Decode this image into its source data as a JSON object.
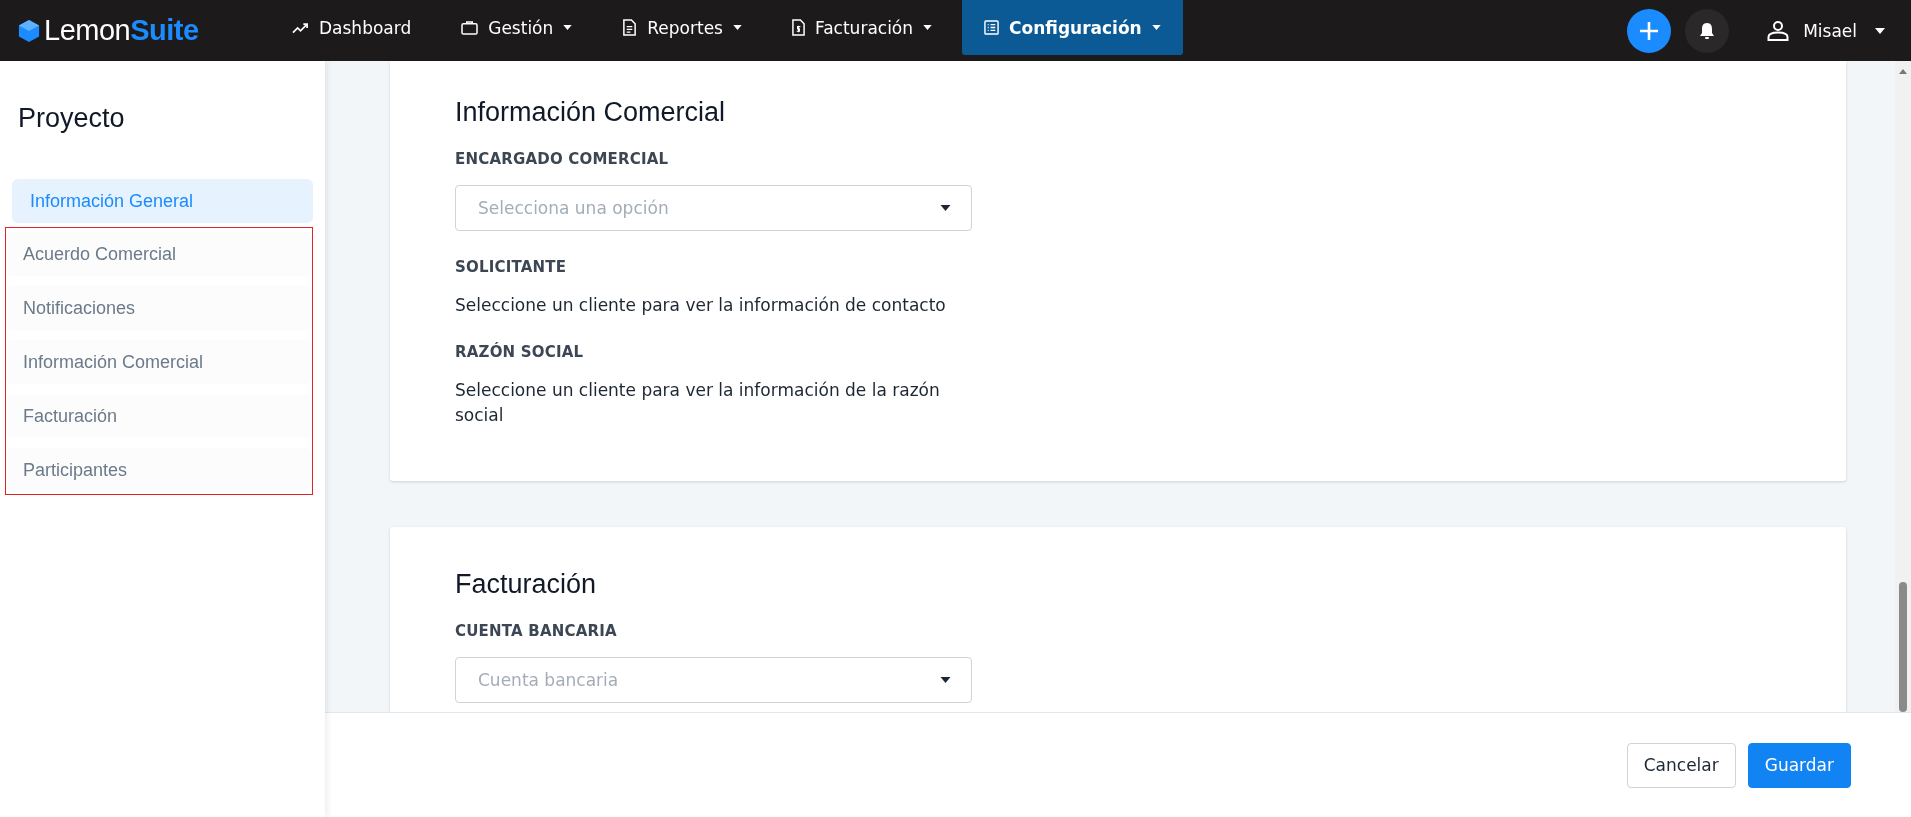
{
  "navbar": {
    "logo": {
      "text": "Lemon",
      "accent": "Suite"
    },
    "items": [
      {
        "label": "Dashboard",
        "dropdown": false,
        "selected": false
      },
      {
        "label": "Gestión",
        "dropdown": true,
        "selected": false
      },
      {
        "label": "Reportes",
        "dropdown": true,
        "selected": false
      },
      {
        "label": "Facturación",
        "dropdown": true,
        "selected": false
      },
      {
        "label": "Configuración",
        "dropdown": true,
        "selected": true
      }
    ],
    "user": {
      "name": "Misael"
    }
  },
  "sidebar": {
    "title": "Proyecto",
    "items": [
      {
        "label": "Información General",
        "selected": true,
        "highlighted": false
      },
      {
        "label": "Acuerdo Comercial",
        "selected": false,
        "highlighted": true
      },
      {
        "label": "Notificaciones",
        "selected": false,
        "highlighted": true
      },
      {
        "label": "Información Comercial",
        "selected": false,
        "highlighted": true
      },
      {
        "label": "Facturación",
        "selected": false,
        "highlighted": true
      },
      {
        "label": "Participantes",
        "selected": false,
        "highlighted": true
      }
    ]
  },
  "sections": [
    {
      "title": "Información Comercial",
      "fields": [
        {
          "kind": "select",
          "label": "ENCARGADO COMERCIAL",
          "placeholder": "Selecciona una opción"
        },
        {
          "kind": "text",
          "label": "SOLICITANTE",
          "value": "Seleccione un cliente para ver la información de contacto"
        },
        {
          "kind": "text",
          "label": "RAZÓN SOCIAL",
          "value": "Seleccione un cliente para ver la información de la razón social"
        }
      ]
    },
    {
      "title": "Facturación",
      "fields": [
        {
          "kind": "select",
          "label": "CUENTA BANCARIA",
          "placeholder": "Cuenta bancaria"
        }
      ]
    }
  ],
  "footer": {
    "buttons": [
      {
        "label": "Cancelar",
        "kind": "secondary"
      },
      {
        "label": "Guardar",
        "kind": "primary"
      }
    ]
  }
}
